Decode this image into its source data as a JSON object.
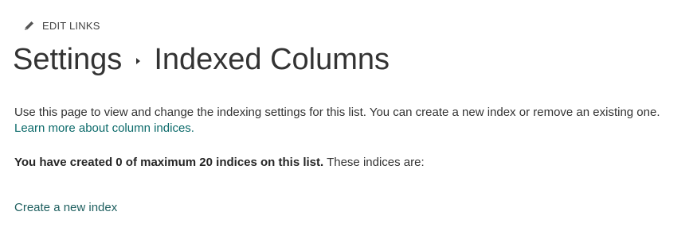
{
  "header": {
    "edit_links_label": "EDIT LINKS",
    "edit_icon": "pencil-icon"
  },
  "title": {
    "part1": "Settings",
    "separator_icon": "triangle-right-icon",
    "part2": "Indexed Columns"
  },
  "intro": {
    "text": "Use this page to view and change the indexing settings for this list. You can create a new index or remove an existing one.",
    "learn_more_link": "Learn more about column indices."
  },
  "status": {
    "bold_text": "You have created 0 of maximum 20 indices on this list.",
    "plain_text": " These indices are:"
  },
  "actions": {
    "create_index_link": "Create a new index"
  },
  "colors": {
    "text": "#333333",
    "link": "#0b6a6a"
  }
}
